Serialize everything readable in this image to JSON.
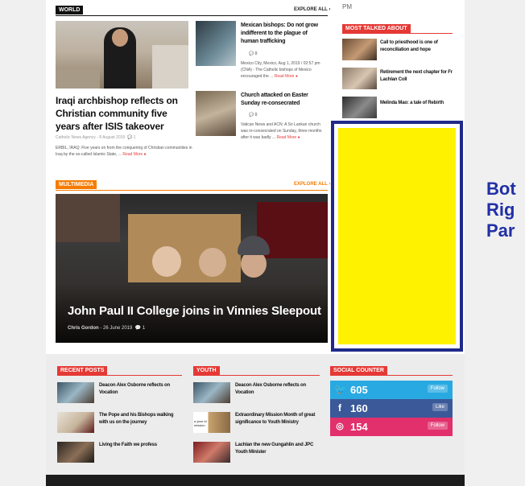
{
  "top_partial": "PM",
  "world": {
    "section_label": "WORLD",
    "explore_label": "EXPLORE ALL ›",
    "main": {
      "title": "Iraqi archbishop reflects on Christian community five years after ISIS takeover",
      "meta": "Catholic News Agency - 8 August 2019",
      "comments": "1",
      "excerpt": "ERBIL, IRAQ: Five years on from the conquering of Christian communities in Iraq by the so-called Islamic State, ...",
      "read_more": "Read More"
    },
    "side": [
      {
        "title": "Mexican bishops: Do not grow indifferent to the plague of human trafficking",
        "comments": "0",
        "excerpt": "Mexico City, Mexico, Aug 1, 2019 / 02:57 pm (CNA) - The Catholic bishops of Mexico encouraged the ...",
        "read_more": "Read More"
      },
      {
        "title": "Church attacked on Easter Sunday re-consecrated",
        "comments": "0",
        "excerpt": "Vatican News and ACN: A Sri Lankan church was re-consecrated on Sunday, three months after it was badly ...",
        "read_more": "Read More"
      }
    ]
  },
  "most_talked": {
    "label": "MOST TALKED ABOUT",
    "items": [
      "Call to priesthood is one of reconciliation and hope",
      "Retirement the next chapter for Fr Lachlan Coll",
      "Melinda Mao: a tale of Rebirth"
    ]
  },
  "multimedia": {
    "label": "MULTIMEDIA",
    "explore_label": "EXPLORE ALL ›",
    "feature": {
      "title": "John Paul II College joins in Vinnies Sleepout",
      "author": "Chris Gordon",
      "date": "- 26 June 2019",
      "comments": "1"
    }
  },
  "ad_panel": {
    "fill": "#fff200",
    "border": "#1f2a8a",
    "side_label": [
      "Bot",
      "Rig",
      "Par"
    ]
  },
  "recent_posts": {
    "label": "RECENT POSTS",
    "items": [
      "Deacon Alex Osborne reflects on Vocation",
      "The Pope and his Bishops walking with us on the journey",
      "Living the Faith we profess"
    ]
  },
  "youth": {
    "label": "YOUTH",
    "items": [
      "Deacon Alex Osborne reflects on Vocation",
      "Extraordinary Mission Month of great significance to Youth Ministry",
      "Lachlan the new Gungahlin and JPC Youth Minister"
    ],
    "thumb_caption": "a year of mission"
  },
  "social_counter": {
    "label": "SOCIAL COUNTER",
    "rows": [
      {
        "icon": "twitter-icon",
        "count": "605",
        "action": "Follow",
        "color": "#29a9e1"
      },
      {
        "icon": "facebook-icon",
        "count": "160",
        "action": "Like",
        "color": "#3b5998"
      },
      {
        "icon": "instagram-icon",
        "count": "154",
        "action": "Follow",
        "color": "#e1306c"
      }
    ]
  },
  "colors": {
    "accent": "#e53935",
    "orange": "#f57c00",
    "navy": "#2130a6"
  }
}
